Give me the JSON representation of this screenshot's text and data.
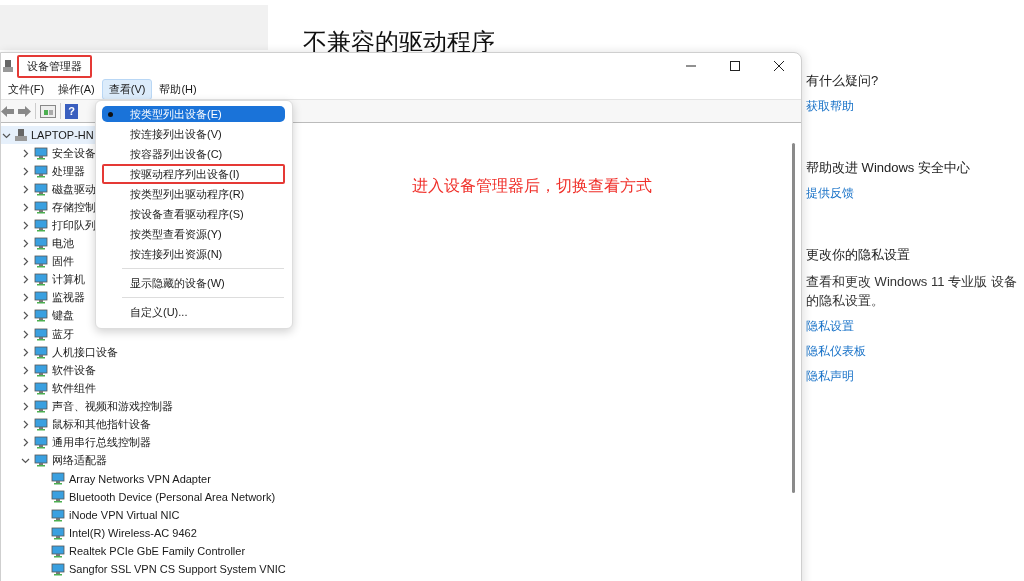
{
  "page": {
    "heading": "不兼容的驱动程序"
  },
  "side_panel": {
    "sections": [
      {
        "title": "有什么疑问?",
        "links": [
          "获取帮助"
        ]
      },
      {
        "title": "帮助改进 Windows 安全中心",
        "links": [
          "提供反馈"
        ]
      },
      {
        "title": "更改你的隐私设置",
        "text": "查看和更改 Windows 11 专业版 设备的隐私设置。",
        "links": [
          "隐私设置",
          "隐私仪表板",
          "隐私声明"
        ]
      }
    ]
  },
  "window": {
    "title": "设备管理器",
    "title_annotated": true,
    "menu_bar": [
      {
        "label": "文件(F)",
        "selected": false
      },
      {
        "label": "操作(A)",
        "selected": false
      },
      {
        "label": "查看(V)",
        "selected": true
      },
      {
        "label": "帮助(H)",
        "selected": false
      }
    ],
    "toolbar": {
      "help_icon": "?"
    },
    "view_menu": {
      "groups": [
        [
          {
            "label": "按类型列出设备(E)",
            "selected": true,
            "annotated": false
          },
          {
            "label": "按连接列出设备(V)",
            "selected": false,
            "annotated": false
          },
          {
            "label": "按容器列出设备(C)",
            "selected": false,
            "annotated": false
          },
          {
            "label": "按驱动程序列出设备(I)",
            "selected": false,
            "annotated": true
          },
          {
            "label": "按类型列出驱动程序(R)",
            "selected": false,
            "annotated": false
          },
          {
            "label": "按设备查看驱动程序(S)",
            "selected": false,
            "annotated": false
          },
          {
            "label": "按类型查看资源(Y)",
            "selected": false,
            "annotated": false
          },
          {
            "label": "按连接列出资源(N)",
            "selected": false,
            "annotated": false
          }
        ],
        [
          {
            "label": "显示隐藏的设备(W)",
            "selected": false,
            "annotated": false
          }
        ],
        [
          {
            "label": "自定义(U)...",
            "selected": false,
            "annotated": false
          }
        ]
      ]
    },
    "tree": [
      {
        "label": "LAPTOP-HN",
        "expanded": true,
        "children": [
          {
            "label": "安全设备",
            "expanded": false
          },
          {
            "label": "处理器",
            "expanded": false
          },
          {
            "label": "磁盘驱动",
            "expanded": false
          },
          {
            "label": "存储控制",
            "expanded": false
          },
          {
            "label": "打印队列",
            "expanded": false
          },
          {
            "label": "电池",
            "expanded": false
          },
          {
            "label": "固件",
            "expanded": false
          },
          {
            "label": "计算机",
            "expanded": false
          },
          {
            "label": "监视器",
            "expanded": false
          },
          {
            "label": "键盘",
            "expanded": false
          },
          {
            "label": "蓝牙",
            "expanded": false
          },
          {
            "label": "人机接口设备",
            "expanded": false
          },
          {
            "label": "软件设备",
            "expanded": false
          },
          {
            "label": "软件组件",
            "expanded": false
          },
          {
            "label": "声音、视频和游戏控制器",
            "expanded": false
          },
          {
            "label": "鼠标和其他指针设备",
            "expanded": false
          },
          {
            "label": "通用串行总线控制器",
            "expanded": false
          },
          {
            "label": "网络适配器",
            "expanded": true,
            "children": [
              {
                "label": "Array Networks VPN Adapter"
              },
              {
                "label": "Bluetooth Device (Personal Area Network)"
              },
              {
                "label": "iNode VPN Virtual NIC"
              },
              {
                "label": "Intel(R) Wireless-AC 9462"
              },
              {
                "label": "Realtek PCIe GbE Family Controller"
              },
              {
                "label": "Sangfor SSL VPN CS Support System VNIC"
              }
            ]
          }
        ]
      }
    ]
  },
  "annotation": {
    "text": "进入设备管理器后，切换查看方式"
  }
}
